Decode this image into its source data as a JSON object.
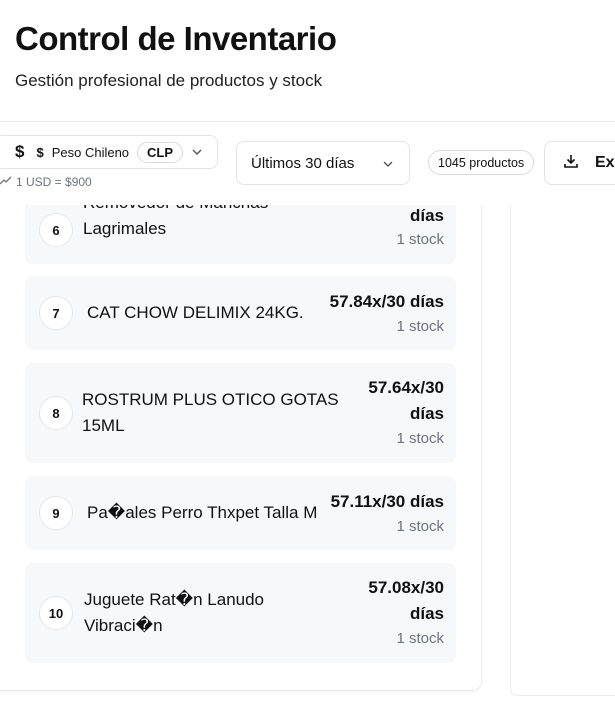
{
  "header": {
    "title": "Control de Inventario",
    "subtitle": "Gestión profesional de productos y stock"
  },
  "toolbar": {
    "currency_symbol": "$",
    "currency_symbol_small": "$",
    "currency_name": "Peso Chileno",
    "currency_code": "CLP",
    "exchange_rate": "1 USD = $900",
    "period": "Últimos 30 días",
    "product_count": "1045 productos",
    "export_label": "Ex"
  },
  "items": [
    {
      "rank": "6",
      "name_line1": "Removedor de Manchas",
      "name_line2": "Lagrimales",
      "rate_line2": "días",
      "stock": "1 stock"
    },
    {
      "rank": "7",
      "name": "CAT CHOW DELIMIX 24KG.",
      "rate": "57.84x/30 días",
      "stock": "1 stock"
    },
    {
      "rank": "8",
      "name_line1": "ROSTRUM PLUS OTICO GOTAS",
      "name_line2": "15ML",
      "rate_line1": "57.64x/30",
      "rate_line2": "días",
      "stock": "1 stock"
    },
    {
      "rank": "9",
      "name": "Pa�ales Perro Thxpet Talla M",
      "rate": "57.11x/30 días",
      "stock": "1 stock"
    },
    {
      "rank": "10",
      "name_line1": "Juguete Rat�n Lanudo",
      "name_line2": "Vibraci�n",
      "rate_line1": "57.08x/30",
      "rate_line2": "días",
      "stock": "1 stock"
    }
  ],
  "icons": {
    "currency": "dollar-icon",
    "dropdown": "chevron-down-icon",
    "trend": "trending-up-icon",
    "export": "download-icon"
  }
}
